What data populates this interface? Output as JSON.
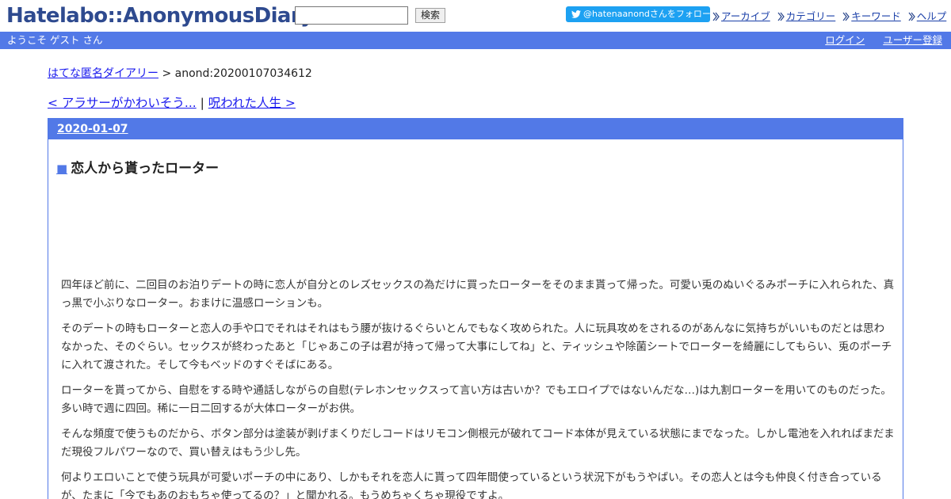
{
  "header": {
    "logo": "Hatelabo::AnonymousDiary",
    "search_placeholder": "",
    "search_button": "検索",
    "follow_button": "@hatenaanondさんをフォロー",
    "links": [
      "アーカイブ",
      "カテゴリー",
      "キーワード",
      "ヘルプ"
    ]
  },
  "bar": {
    "welcome": "ようこそ ゲスト さん",
    "login": "ログイン",
    "register": "ユーザー登録"
  },
  "breadcrumb": {
    "home": "はてな匿名ダイアリー",
    "separator": " > ",
    "current": "anond:20200107034612"
  },
  "nav": {
    "prev": "< アラサーがかわいそう...",
    "separator": " | ",
    "next": "呪われた人生 >"
  },
  "day": {
    "date": "2020-01-07",
    "title_marker": "■",
    "title": "恋人から貰ったローター",
    "paragraphs": [
      "四年ほど前に、二回目のお泊りデートの時に恋人が自分とのレズセックスの為だけに買ったローターをそのまま貰って帰った。可愛い兎のぬいぐるみポーチに入れられた、真っ黒で小ぶりなローター。おまけに温感ローションも。",
      "そのデートの時もローターと恋人の手や口でそれはそれはもう腰が抜けるぐらいとんでもなく攻められた。人に玩具攻めをされるのがあんなに気持ちがいいものだとは思わなかった、そのぐらい。セックスが終わったあと「じゃあこの子は君が持って帰って大事にしてね」と、ティッシュや除菌シートでローターを綺麗にしてもらい、兎のポーチに入れて渡された。そして今もベッドのすぐそばにある。",
      "ローターを貰ってから、自慰をする時や通話しながらの自慰(テレホンセックスって言い方は古いか？でもエロイプではないんだな…)は九割ローターを用いてのものだった。多い時で週に四回。稀に一日二回するが大体ローターがお供。",
      "そんな頻度で使うものだから、ボタン部分は塗装が剥げまくりだしコードはリモコン側根元が破れてコード本体が見えている状態にまでなった。しかし電池を入れればまだまだ現役フルパワーなので、買い替えはもう少し先。",
      "何よりエロいことで使う玩具が可愛いポーチの中にあり、しかもそれを恋人に貰って四年間使っているという状況下がもうやばい。その恋人とは今も仲良く付き合っているが、たまに「今でもあのおもちゃ使ってるの？」と聞かれる。もうめちゃくちゃ現役ですよ。"
    ]
  },
  "colors": {
    "brand_blue": "#5279e7",
    "logo_blue": "#2e4a8f",
    "twitter_blue": "#1da1f2",
    "link_blue": "#1a1aee"
  }
}
